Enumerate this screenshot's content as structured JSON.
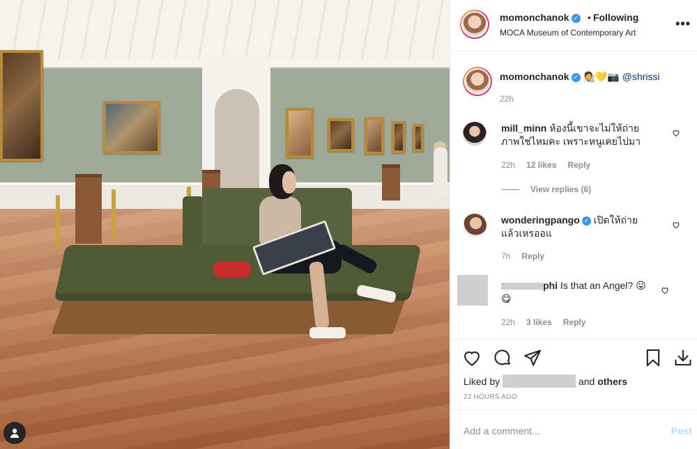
{
  "header": {
    "username": "momonchanok",
    "following_label": "Following",
    "location": "MOCA Museum of Contemporary Art",
    "more_label": "•••"
  },
  "caption": {
    "username": "momonchanok",
    "emoji": "🧑‍🎨💛📷",
    "mention": "@shrissi",
    "time": "22h"
  },
  "comments": [
    {
      "username": "mill_minn",
      "text_line1": "ห้องนี้เขาจะไม่ให้ถ่าย",
      "text_line2": "ภาพใช่ไหมคะ เพราะหนูเคยไปมา",
      "time": "22h",
      "likes": "12 likes",
      "reply_label": "Reply",
      "view_replies": "View replies (6)"
    },
    {
      "username": "wonderingpango",
      "text_line1": "เปิดให้ถ่าย",
      "text_line2": "แล้วเหรออแ",
      "time": "7h",
      "reply_label": "Reply"
    },
    {
      "username_partial": "phi",
      "text": "Is that an Angel? 😛",
      "text_line2": "😋",
      "time": "22h",
      "likes": "3 likes",
      "reply_label": "Reply"
    }
  ],
  "actions": {
    "liked_by_prefix": "Liked by",
    "liked_by_suffix": "and",
    "others_label": "others",
    "time_ago": "22 HOURS AGO"
  },
  "composer": {
    "placeholder": "Add a comment...",
    "post_label": "Post"
  },
  "colors": {
    "verified_blue": "#3897f0",
    "post_disabled": "#b2dffc",
    "meta_gray": "#8e8e8e"
  },
  "icons": [
    "verified-icon",
    "more-icon",
    "heart-icon",
    "comment-icon",
    "share-icon",
    "bookmark-icon",
    "download-icon",
    "user-tag-icon"
  ]
}
